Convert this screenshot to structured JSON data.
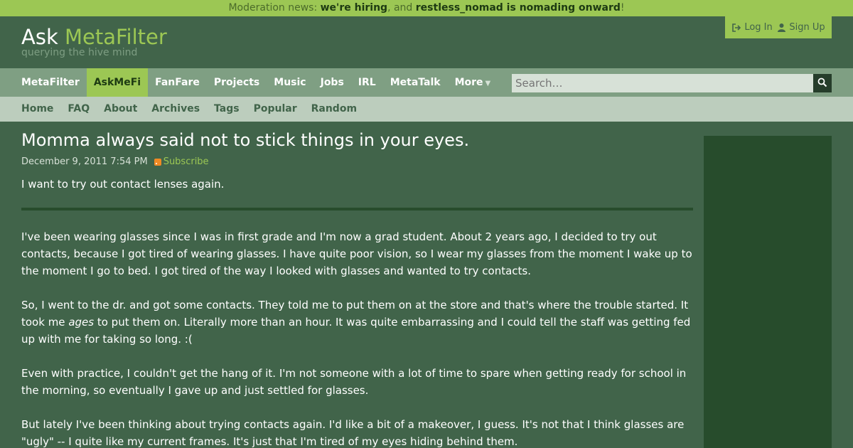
{
  "moderation_bar": {
    "prefix": "Moderation news: ",
    "link1": "we're hiring",
    "middle": ", and ",
    "link2": "restless_nomad is nomading onward",
    "suffix": "!"
  },
  "header": {
    "logo_ask": "Ask ",
    "logo_mf": "MetaFilter",
    "tagline": "querying the hive mind",
    "login": "Log In",
    "signup": "Sign Up"
  },
  "nav": {
    "items": [
      "MetaFilter",
      "AskMeFi",
      "FanFare",
      "Projects",
      "Music",
      "Jobs",
      "IRL",
      "MetaTalk",
      "More"
    ],
    "active": "AskMeFi",
    "search_placeholder": "Search…"
  },
  "subnav": {
    "items": [
      "Home",
      "FAQ",
      "About",
      "Archives",
      "Tags",
      "Popular",
      "Random"
    ]
  },
  "post": {
    "title": "Momma always said not to stick things in your eyes.",
    "date": "December 9, 2011 7:54 PM",
    "subscribe": "Subscribe",
    "above_fold": "I want to try out contact lenses again.",
    "p1": "I've been wearing glasses since I was in first grade and I'm now a grad student. About 2 years ago, I decided to try out contacts, because I got tired of wearing glasses. I have quite poor vision, so I wear my glasses from the moment I wake up to the moment I go to bed. I got tired of the way I looked with glasses and wanted to try contacts.",
    "p2_before": "So, I went to the dr. and got some contacts. They told me to put them on at the store and that's where the trouble started. It took me ",
    "p2_em": "ages",
    "p2_after": " to put them on. Literally more than an hour. It was quite embarrassing and I could tell the staff was getting fed up with me for taking so long. :(",
    "p3": "Even with practice, I couldn't get the hang of it. I'm not someone with a lot of time to spare when getting ready for school in the morning, so eventually I gave up and just settled for glasses.",
    "p4": "But lately I've been thinking about trying contacts again. I'd like a bit of a makeover, I guess. It's not that I think glasses are \"ugly\" -- I quite like my current frames. It's just that I'm tired of my eyes hiding behind them."
  },
  "colors": {
    "page_bg": "#41644a",
    "accent": "#9cc754",
    "nav_bg": "#7f9f83",
    "subnav_bg": "#bccdbd",
    "sidebar_bg": "#274c2c"
  }
}
